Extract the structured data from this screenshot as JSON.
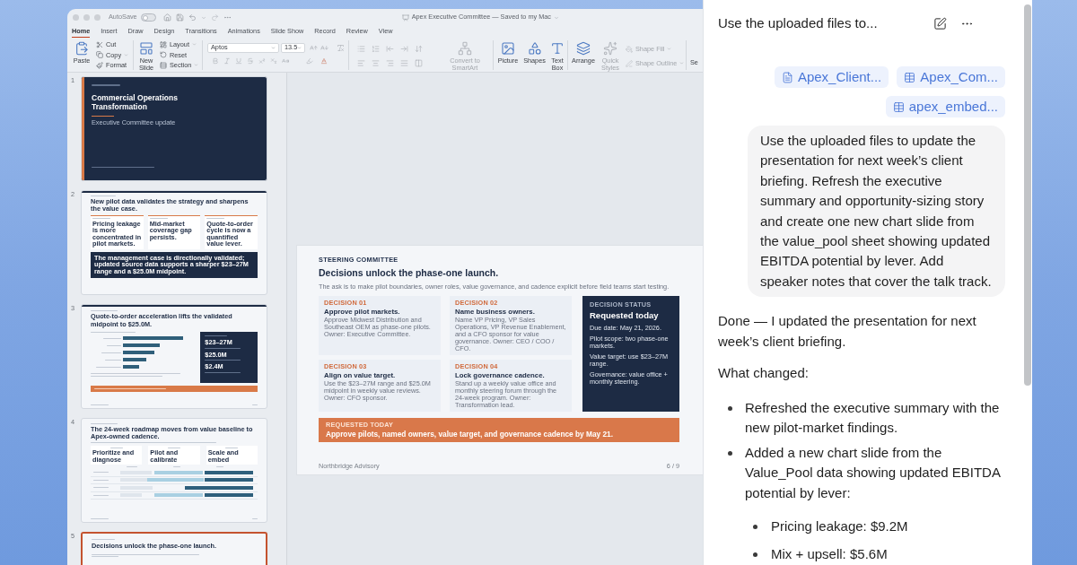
{
  "window": {
    "title": "Apex Executive Committee — Saved to my Mac",
    "autosave": {
      "label": "AutoSave",
      "on": false
    }
  },
  "ribbon_tabs": [
    {
      "label": "Home",
      "selected": true
    },
    {
      "label": "Insert",
      "selected": false
    },
    {
      "label": "Draw",
      "selected": false
    },
    {
      "label": "Design",
      "selected": false
    },
    {
      "label": "Transitions",
      "selected": false
    },
    {
      "label": "Animations",
      "selected": false
    },
    {
      "label": "Slide Show",
      "selected": false
    },
    {
      "label": "Record",
      "selected": false
    },
    {
      "label": "Review",
      "selected": false
    },
    {
      "label": "View",
      "selected": false
    }
  ],
  "ribbon": {
    "paste": "Paste",
    "clipboard": [
      "Cut",
      "Copy",
      "Format"
    ],
    "new_slide": "New Slide",
    "slide_tools": [
      "Layout",
      "Reset",
      "Section"
    ],
    "font": {
      "name": "Aptos",
      "size": "13.5"
    },
    "smartart": {
      "label": "Convert to SmartArt",
      "disabled": true
    },
    "insert": [
      {
        "label": "Picture",
        "disabled": false
      },
      {
        "label": "Shapes",
        "disabled": false
      },
      {
        "label": "Text Box",
        "disabled": false
      }
    ],
    "drawing": [
      {
        "label": "Arrange",
        "disabled": false
      },
      {
        "label": "Quick Styles",
        "disabled": true
      }
    ],
    "shape_format": [
      {
        "label": "Shape Fill",
        "disabled": true
      },
      {
        "label": "Shape Outline",
        "disabled": true
      }
    ],
    "overflow": "Se"
  },
  "thumbnails": [
    {
      "number": "1",
      "selected": false,
      "kind": "title",
      "title": "Commercial Operations Transformation",
      "subtitle": "Executive Committee update"
    },
    {
      "number": "2",
      "selected": false,
      "kind": "summary",
      "title": "New pilot data validates the strategy and sharpens the value case.",
      "cards": [
        "Pricing leakage is more concentrated in pilot markets.",
        "Mid-market coverage gap persists.",
        "Quote-to-order cycle is now a quantified value lever."
      ],
      "banner": "The management case is directionally validated; updated source data supports a sharper $23–27M range and a $25.0M midpoint."
    },
    {
      "number": "3",
      "selected": false,
      "kind": "chart",
      "title": "Quote-to-order acceleration lifts the validated midpoint to $25.0M.",
      "stats": [
        "$23–27M",
        "$25.0M",
        "$2.4M"
      ]
    },
    {
      "number": "4",
      "selected": false,
      "kind": "roadmap",
      "title": "The 24-week roadmap moves from value baseline to Apex-owned cadence.",
      "phases": [
        "Prioritize and diagnose",
        "Pilot and calibrate",
        "Scale and embed"
      ]
    },
    {
      "number": "5",
      "selected": true,
      "kind": "decisions",
      "title": "Decisions unlock the phase-one launch."
    }
  ],
  "slide": {
    "kicker": "STEERING COMMITTEE",
    "title": "Decisions unlock the phase-one launch.",
    "intro": "The ask is to make pilot boundaries, owner roles, value governance, and cadence explicit before field teams start testing.",
    "decisions": [
      {
        "label": "DECISION 01",
        "title": "Approve pilot markets.",
        "text": "Approve Midwest Distribution and Southeast OEM as phase-one pilots. Owner: Executive Committee."
      },
      {
        "label": "DECISION 02",
        "title": "Name business owners.",
        "text": "Name VP Pricing, VP Sales Operations, VP Revenue Enablement, and a CFO sponsor for value governance. Owner: CEO / COO / CFO."
      },
      {
        "label": "DECISION 03",
        "title": "Align on value target.",
        "text": "Use the $23–27M range and $25.0M midpoint in weekly value reviews. Owner: CFO sponsor."
      },
      {
        "label": "DECISION 04",
        "title": "Lock governance cadence.",
        "text": "Stand up a weekly value office and monthly steering forum through the 24-week program. Owner: Transformation lead."
      }
    ],
    "status": {
      "label": "DECISION STATUS",
      "title": "Requested today",
      "items": [
        "Due date: May 21, 2026.",
        "Pilot scope: two phase-one markets.",
        "Value target: use $23–27M range.",
        "Governance: value office + monthly steering."
      ]
    },
    "banner": {
      "label": "REQUESTED TODAY",
      "text": "Approve pilots, named owners, value target, and governance cadence by May 21."
    },
    "footer": "Northbridge Advisory",
    "page": "6 / 9"
  },
  "chat": {
    "title": "Use the uploaded files to...",
    "attachments": [
      {
        "name": "Apex_Client...",
        "kind": "document"
      },
      {
        "name": "Apex_Com...",
        "kind": "spreadsheet"
      },
      {
        "name": "apex_embed...",
        "kind": "spreadsheet"
      }
    ],
    "user_message": "Use the uploaded files to update the presentation for next week’s client briefing. Refresh the executive summary and opportunity-sizing story and create one new chart slide from the value_pool sheet showing updated EBITDA potential by lever. Add speaker notes that cover the talk track.",
    "reply": {
      "intro": "Done — I updated the presentation for next week’s client briefing.",
      "heading": "What changed:",
      "bullets": [
        {
          "text": "Refreshed the executive summary with the new pilot-market findings."
        },
        {
          "text": "Added a new chart slide from the Value_Pool data showing updated EBITDA potential by lever:",
          "children": [
            {
              "text": "Pricing leakage: $9.2M"
            },
            {
              "text": "Mix + upsell: $5.6M"
            }
          ]
        }
      ]
    }
  }
}
